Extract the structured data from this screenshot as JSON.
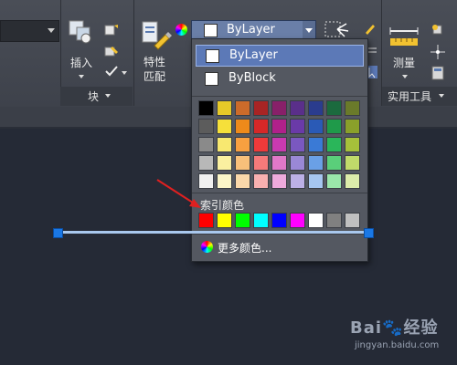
{
  "ribbon": {
    "insert_label": "插入",
    "block_panel_label": "块",
    "match_props_line1": "特性",
    "match_props_line2": "匹配",
    "measure_label": "测量",
    "utilities_panel_label": "实用工具"
  },
  "color_combo": {
    "selected_value": "ByLayer",
    "swatch_color": "#ffffff"
  },
  "color_dropdown": {
    "items": [
      {
        "label": "ByLayer",
        "selected": true
      },
      {
        "label": "ByBlock",
        "selected": false
      }
    ],
    "palette_rows": [
      [
        "#000000",
        "#e6c928",
        "#cc6b2a",
        "#a82424",
        "#882069",
        "#5a2f8a",
        "#2a3c8e",
        "#1b6a3e",
        "#6a7a2a"
      ],
      [
        "#5c5c5c",
        "#f6e03a",
        "#ee8a1a",
        "#d62828",
        "#b0218a",
        "#6a3aa8",
        "#2a5ab6",
        "#1f9a4a",
        "#8aa02a"
      ],
      [
        "#8a8a8a",
        "#f8e870",
        "#f8a040",
        "#ef3a3a",
        "#c83ab0",
        "#7a58c0",
        "#3a7ad6",
        "#2ab65a",
        "#a6c03a"
      ],
      [
        "#b8b8b8",
        "#faf0a0",
        "#f8c07a",
        "#f57a7a",
        "#e078c8",
        "#9a88d6",
        "#6aa0e6",
        "#5acf7a",
        "#c0da6a"
      ],
      [
        "#f0f0f0",
        "#fcf6c8",
        "#fad8aa",
        "#f8b0b0",
        "#eeaadb",
        "#bcb0e6",
        "#a6c6f0",
        "#9ae6aa",
        "#dcecaa"
      ]
    ],
    "index_color_label": "索引颜色",
    "index_colors": [
      "#ff0000",
      "#ffff00",
      "#00ff00",
      "#00ffff",
      "#0000ff",
      "#ff00ff",
      "#ffffff",
      "#808080",
      "#c0c0c0"
    ],
    "more_colors_label": "更多颜色..."
  },
  "watermark": {
    "logo_text": "Bai🐾经验",
    "url_text": "jingyan.baidu.com"
  }
}
